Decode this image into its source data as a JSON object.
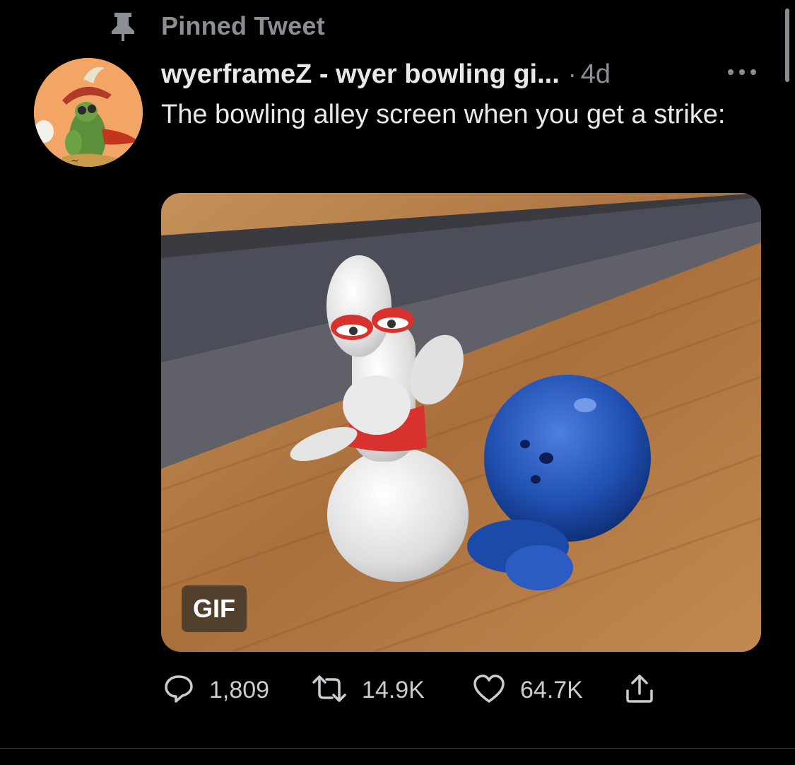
{
  "pinned": {
    "label": "Pinned Tweet",
    "icon": "pin-icon"
  },
  "tweet": {
    "author_name": "wyerframeZ - wyer bowling gi...",
    "separator": "·",
    "timestamp": "4d",
    "more_icon": "more-icon",
    "text": "The bowling alley screen when you get a strike:",
    "media": {
      "badge": "GIF"
    }
  },
  "actions": {
    "reply": {
      "icon": "reply-icon",
      "count": "1,809"
    },
    "retweet": {
      "icon": "retweet-icon",
      "count": "14.9K"
    },
    "like": {
      "icon": "heart-icon",
      "count": "64.7K"
    },
    "share": {
      "icon": "share-icon"
    }
  },
  "colors": {
    "background": "#000000",
    "primary_text": "#e7e9ea",
    "secondary_text": "#8b8f95",
    "avatar_bg": "#f3a565",
    "lane_wood": "#b07a44",
    "bowling_ball": "#1f4fb0",
    "pin_stripe": "#d8322e"
  }
}
